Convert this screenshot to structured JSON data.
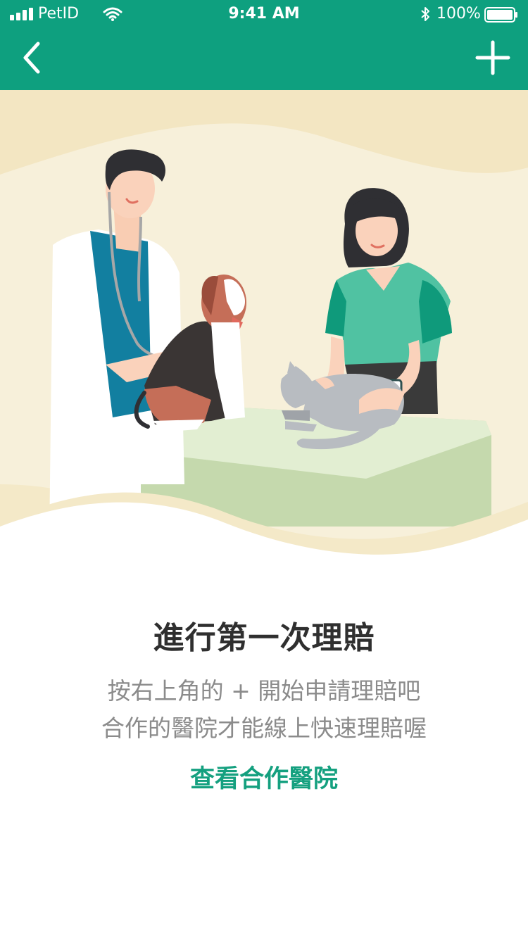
{
  "status_bar": {
    "carrier": "PetID",
    "time": "9:41 AM",
    "battery": "100%"
  },
  "nav": {
    "back_icon": "chevron-left-icon",
    "add_icon": "plus-icon",
    "bg_color": "#0ea07f"
  },
  "content": {
    "title": "進行第一次理賠",
    "line1": "按右上角的 + 開始申請理賠吧",
    "line2": "合作的醫院才能線上快速理賠喔",
    "link": "查看合作醫院"
  },
  "colors": {
    "accent": "#14a07f",
    "title": "#2f2f2f",
    "body": "#8b8b8b"
  }
}
